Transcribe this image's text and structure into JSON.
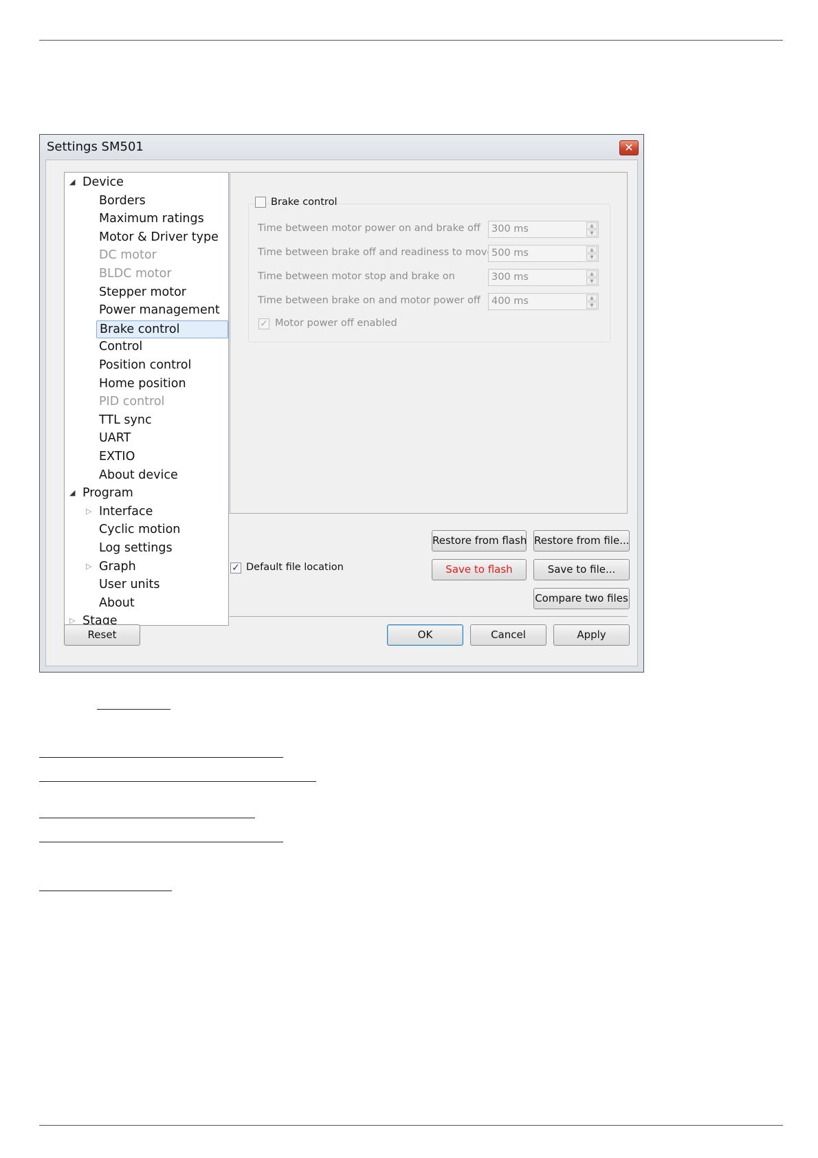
{
  "window": {
    "title": "Settings SM501",
    "close_glyph": "✕"
  },
  "tree": {
    "items": [
      {
        "label": "Device",
        "level": 0,
        "expander": "expanded",
        "state": "normal"
      },
      {
        "label": "Borders",
        "level": 1,
        "expander": "none",
        "state": "normal"
      },
      {
        "label": "Maximum ratings",
        "level": 1,
        "expander": "none",
        "state": "normal"
      },
      {
        "label": "Motor & Driver type",
        "level": 1,
        "expander": "none",
        "state": "normal"
      },
      {
        "label": "DC motor",
        "level": 1,
        "expander": "none",
        "state": "disabled"
      },
      {
        "label": "BLDC motor",
        "level": 1,
        "expander": "none",
        "state": "disabled"
      },
      {
        "label": "Stepper motor",
        "level": 1,
        "expander": "none",
        "state": "normal"
      },
      {
        "label": "Power management",
        "level": 1,
        "expander": "none",
        "state": "normal"
      },
      {
        "label": "Brake control",
        "level": 1,
        "expander": "none",
        "state": "selected"
      },
      {
        "label": "Control",
        "level": 1,
        "expander": "none",
        "state": "normal"
      },
      {
        "label": "Position control",
        "level": 1,
        "expander": "none",
        "state": "normal"
      },
      {
        "label": "Home position",
        "level": 1,
        "expander": "none",
        "state": "normal"
      },
      {
        "label": "PID control",
        "level": 1,
        "expander": "none",
        "state": "disabled"
      },
      {
        "label": "TTL sync",
        "level": 1,
        "expander": "none",
        "state": "normal"
      },
      {
        "label": "UART",
        "level": 1,
        "expander": "none",
        "state": "normal"
      },
      {
        "label": "EXTIO",
        "level": 1,
        "expander": "none",
        "state": "normal"
      },
      {
        "label": "About device",
        "level": 1,
        "expander": "none",
        "state": "normal"
      },
      {
        "label": "Program",
        "level": 0,
        "expander": "expanded",
        "state": "normal"
      },
      {
        "label": "Interface",
        "level": 1,
        "expander": "collapsed",
        "state": "normal"
      },
      {
        "label": "Cyclic motion",
        "level": 1,
        "expander": "none",
        "state": "normal"
      },
      {
        "label": "Log settings",
        "level": 1,
        "expander": "none",
        "state": "normal"
      },
      {
        "label": "Graph",
        "level": 1,
        "expander": "collapsed",
        "state": "normal"
      },
      {
        "label": "User units",
        "level": 1,
        "expander": "none",
        "state": "normal"
      },
      {
        "label": "About",
        "level": 1,
        "expander": "none",
        "state": "normal"
      },
      {
        "label": "Stage",
        "level": 0,
        "expander": "collapsed",
        "state": "normal"
      }
    ]
  },
  "brake": {
    "group_label": "Brake control",
    "group_checked": false,
    "rows": [
      {
        "label": "Time between motor power on and brake off",
        "value": "300 ms"
      },
      {
        "label": "Time between brake off and readiness to move",
        "value": "500 ms"
      },
      {
        "label": "Time between motor stop and brake on",
        "value": "300 ms"
      },
      {
        "label": "Time between brake on and motor power off",
        "value": "400 ms"
      }
    ],
    "power_off_label": "Motor power off enabled",
    "power_off_checked": true
  },
  "file": {
    "default_location_label": "Default file location",
    "default_location_checked": true,
    "restore_flash": "Restore from flash",
    "restore_file": "Restore from file...",
    "save_flash": "Save to flash",
    "save_file": "Save to file...",
    "compare": "Compare two files"
  },
  "footer": {
    "reset": "Reset",
    "ok": "OK",
    "cancel": "Cancel",
    "apply": "Apply"
  },
  "colors": {
    "save_flash_text": "#e01c1c",
    "selection_bg": "#e2eefb",
    "close_btn": "#c7442b"
  },
  "icons": {
    "expanded": "expanded-triangle-icon",
    "collapsed": "collapsed-triangle-icon",
    "close": "close-icon",
    "check": "checkmark-icon"
  }
}
